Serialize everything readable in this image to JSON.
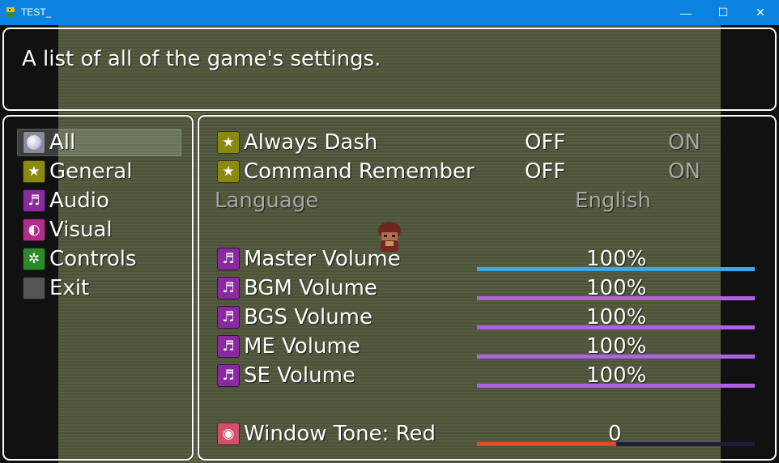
{
  "window": {
    "title": "TEST_",
    "minimize_glyph": "—",
    "maximize_glyph": "☐",
    "close_glyph": "✕"
  },
  "help": {
    "text": "A list of all of the game's settings."
  },
  "categories": [
    {
      "label": "All",
      "icon": "orb-icon",
      "selected": true
    },
    {
      "label": "General",
      "icon": "star-icon"
    },
    {
      "label": "Audio",
      "icon": "harp-icon"
    },
    {
      "label": "Visual",
      "icon": "eye-icon"
    },
    {
      "label": "Controls",
      "icon": "gear-icon"
    },
    {
      "label": "Exit",
      "icon": "blank-icon"
    }
  ],
  "options": {
    "always_dash": {
      "label": "Always Dash",
      "off": "OFF",
      "on": "ON",
      "value": "OFF"
    },
    "command_remember": {
      "label": "Command Remember",
      "off": "OFF",
      "on": "ON",
      "value": "OFF"
    },
    "language": {
      "label": "Language",
      "value": "English",
      "enabled": false
    },
    "master_volume": {
      "label": "Master Volume",
      "value": "100%",
      "fraction": 1.0,
      "color": "#3fa8e0"
    },
    "bgm_volume": {
      "label": "BGM Volume",
      "value": "100%",
      "fraction": 1.0,
      "color": "#b060e0"
    },
    "bgs_volume": {
      "label": "BGS Volume",
      "value": "100%",
      "fraction": 1.0,
      "color": "#b060e0"
    },
    "me_volume": {
      "label": "ME Volume",
      "value": "100%",
      "fraction": 1.0,
      "color": "#b060e0"
    },
    "se_volume": {
      "label": "SE Volume",
      "value": "100%",
      "fraction": 1.0,
      "color": "#b060e0"
    },
    "window_tone_red": {
      "label": "Window Tone: Red",
      "value": "0",
      "fraction": 0.5,
      "color": "#e04a2a"
    }
  }
}
